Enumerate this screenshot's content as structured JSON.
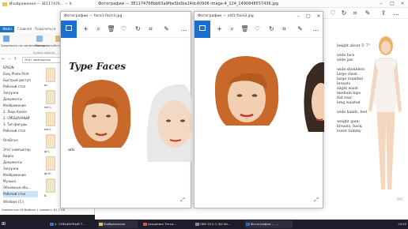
{
  "bg_window": {
    "title": "Фотографии — 3E1174768bb63a9fbe5b0ba24dc40906 image-4_124_1490848557436.jpg",
    "text_groups": [
      [
        "height about 5' 7\""
      ],
      [
        "wide face",
        "wide jaw"
      ],
      [
        "wide shoulders",
        "large chest",
        "large rounded breasts",
        "slight waist",
        "medium hips",
        "flat rear",
        "long waisted"
      ],
      [
        "wide hands, feet"
      ],
      [
        "weight gain:",
        "breasts, back,",
        "lower tummy"
      ]
    ],
    "watermark": "PPC"
  },
  "explorer": {
    "title": "Изображения — 3E117476... — 6",
    "tabs": [
      "Файл",
      "Главная",
      "Поделиться"
    ],
    "ribbon_labels": [
      "Закрепить на панели быстр...",
      "Копировать",
      "Вставить"
    ],
    "clipboard_label": "Буфер обмена",
    "address": "Этот компьютер",
    "search_placeholder": "Поиск",
    "nav_items": [
      "EPSON",
      "Easy Photo Print",
      "Быстрый доступ",
      "Рабочий стол",
      "Загрузки",
      "Документы",
      "Изображения",
      "2. Лицо Кахле",
      "2. СМЕШАННЫЙ",
      "3. Тип фигуры",
      "Рабочий стол",
      "OneDrive",
      "Этот компьютер",
      "Видео",
      "Документы",
      "Загрузки",
      "Изображения",
      "Музыка",
      "Объемные объ...",
      "Рабочий стол",
      "Windows (C:)"
    ],
    "file_names": [
      "ис",
      "ear1-",
      "ear2-",
      "girl-",
      "girl2-",
      "6-"
    ],
    "status": "Элементов: 28   Выбран 1 элемент: 81,2 КБ"
  },
  "viewer1": {
    "title": "Фотографии — face1-face3.jpg",
    "heading": "Type Faces",
    "mark": "ath"
  },
  "viewer2": {
    "title": "Фотографии — old1-face3.jpg"
  },
  "taskbar": {
    "items": [
      "2. СМЕШАННЫЙ Т...",
      "Изображения",
      "Академия Татья...",
      "OBS 25.0.1 (64 bit...",
      "Фотографии — ..."
    ],
    "tray": "16:00"
  },
  "colors": {
    "accent": "#1a6fd0",
    "taskbar": "#1c1c2a",
    "skin": "#f1cfb0",
    "hair": "#c8682a",
    "white_hair": "#e8e8e8"
  }
}
